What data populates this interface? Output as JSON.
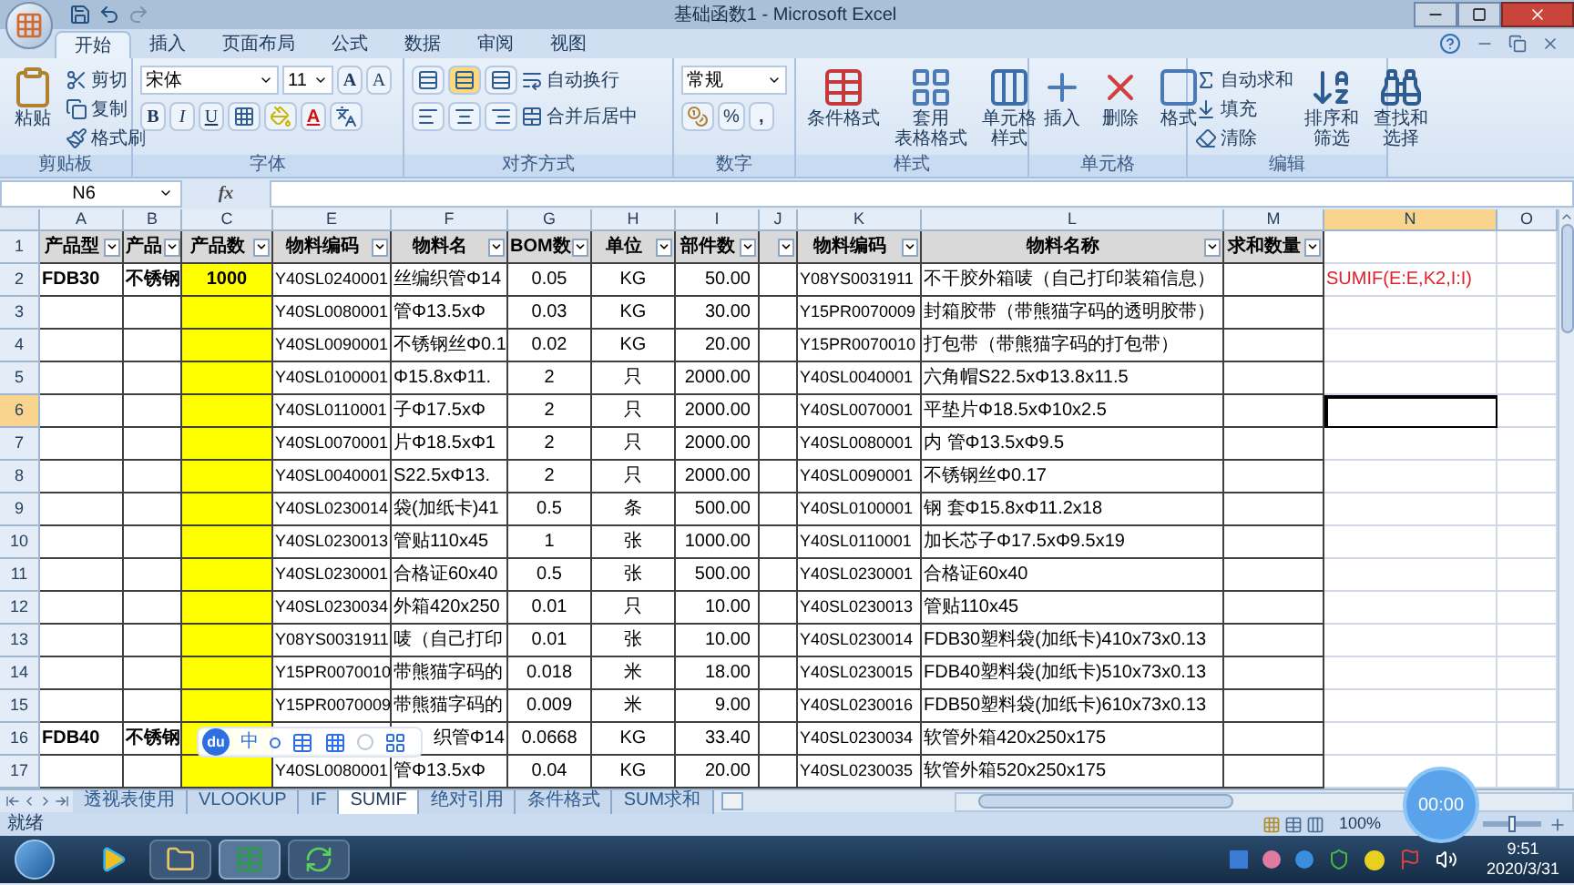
{
  "window": {
    "title": "基础函数1 - Microsoft Excel"
  },
  "ribbon_tabs": [
    {
      "label": "开始",
      "selected": true
    },
    {
      "label": "插入",
      "selected": false
    },
    {
      "label": "页面布局",
      "selected": false
    },
    {
      "label": "公式",
      "selected": false
    },
    {
      "label": "数据",
      "selected": false
    },
    {
      "label": "审阅",
      "selected": false
    },
    {
      "label": "视图",
      "selected": false
    }
  ],
  "ribbon": {
    "clipboard": {
      "label": "剪贴板",
      "paste": "粘贴",
      "small": [
        "剪切",
        "复制",
        "格式刷"
      ]
    },
    "font": {
      "label": "字体",
      "font_name": "宋体",
      "font_size": "11",
      "grow": "A",
      "shrink": "A",
      "bold": "B",
      "italic": "I",
      "underline": "U",
      "font_color": "A"
    },
    "alignment": {
      "label": "对齐方式",
      "wrap": "自动换行",
      "merge": "合并后居中"
    },
    "number": {
      "label": "数字",
      "format": "常规",
      "percent": "%",
      "comma": ","
    },
    "styles": {
      "label": "样式",
      "buttons": [
        [
          "条件格式"
        ],
        [
          "套用",
          "表格格式"
        ],
        [
          "单元格",
          "样式"
        ]
      ]
    },
    "cells": {
      "label": "单元格",
      "buttons": [
        "插入",
        "删除",
        "格式"
      ]
    },
    "editing": {
      "label": "编辑",
      "small": [
        "自动求和",
        "填充",
        "清除"
      ],
      "large": [
        [
          "排序和",
          "筛选"
        ],
        [
          "查找和",
          "选择"
        ]
      ]
    }
  },
  "name_box": "N6",
  "function_label": "fx",
  "columns": [
    {
      "label": "A",
      "selected": false
    },
    {
      "label": "B",
      "selected": false
    },
    {
      "label": "C",
      "selected": false
    },
    {
      "label": "E",
      "selected": false
    },
    {
      "label": "F",
      "selected": false
    },
    {
      "label": "G",
      "selected": false
    },
    {
      "label": "H",
      "selected": false
    },
    {
      "label": "I",
      "selected": false
    },
    {
      "label": "J",
      "selected": false
    },
    {
      "label": "K",
      "selected": false
    },
    {
      "label": "L",
      "selected": false
    },
    {
      "label": "M",
      "selected": false
    },
    {
      "label": "N",
      "selected": true
    },
    {
      "label": "O",
      "selected": false
    }
  ],
  "rows": [
    {
      "number": "1",
      "selected": false,
      "kind": "header",
      "cells": {
        "A": "产品型",
        "B": "产品",
        "C": "产品数",
        "E": "物料编码",
        "F": "物料名",
        "G": "BOM数",
        "H": "单位",
        "I": "部件数",
        "K": "物料编码",
        "L": "物料名称",
        "M": "求和数量"
      }
    },
    {
      "number": "2",
      "selected": false,
      "kind": "data",
      "cells": {
        "A": "FDB30",
        "B": "不锈钢",
        "C": "1000",
        "E": "Y40SL0240001",
        "F": "丝编织管Φ14",
        "G": "0.05",
        "H": "KG",
        "I": "50.00",
        "K": "Y08YS0031911",
        "L": "不干胶外箱唛（自己打印装箱信息）",
        "N": "SUMIF(E:E,K2,I:I)"
      }
    },
    {
      "number": "3",
      "selected": false,
      "kind": "data",
      "cells": {
        "E": "Y40SL0080001",
        "F": "管Φ13.5xΦ",
        "G": "0.03",
        "H": "KG",
        "I": "30.00",
        "K": "Y15PR0070009",
        "L": "封箱胶带（带熊猫字码的透明胶带）"
      }
    },
    {
      "number": "4",
      "selected": false,
      "kind": "data",
      "cells": {
        "E": "Y40SL0090001",
        "F": "不锈钢丝Φ0.1",
        "G": "0.02",
        "H": "KG",
        "I": "20.00",
        "K": "Y15PR0070010",
        "L": "打包带（带熊猫字码的打包带）"
      }
    },
    {
      "number": "5",
      "selected": false,
      "kind": "data",
      "cells": {
        "E": "Y40SL0100001",
        "F": "Φ15.8xΦ11.",
        "G": "2",
        "H": "只",
        "I": "2000.00",
        "K": "Y40SL0040001",
        "L": "六角帽S22.5xΦ13.8x11.5"
      }
    },
    {
      "number": "6",
      "selected": true,
      "kind": "data",
      "cells": {
        "E": "Y40SL0110001",
        "F": "子Φ17.5xΦ",
        "G": "2",
        "H": "只",
        "I": "2000.00",
        "K": "Y40SL0070001",
        "L": "平垫片Φ18.5xΦ10x2.5"
      }
    },
    {
      "number": "7",
      "selected": false,
      "kind": "data",
      "cells": {
        "E": "Y40SL0070001",
        "F": "片Φ18.5xΦ1",
        "G": "2",
        "H": "只",
        "I": "2000.00",
        "K": "Y40SL0080001",
        "L": "内 管Φ13.5xΦ9.5"
      }
    },
    {
      "number": "8",
      "selected": false,
      "kind": "data",
      "cells": {
        "E": "Y40SL0040001",
        "F": "S22.5xΦ13.",
        "G": "2",
        "H": "只",
        "I": "2000.00",
        "K": "Y40SL0090001",
        "L": "不锈钢丝Φ0.17"
      }
    },
    {
      "number": "9",
      "selected": false,
      "kind": "data",
      "cells": {
        "E": "Y40SL0230014",
        "F": "袋(加纸卡)41",
        "G": "0.5",
        "H": "条",
        "I": "500.00",
        "K": "Y40SL0100001",
        "L": "钢 套Φ15.8xΦ11.2x18"
      }
    },
    {
      "number": "10",
      "selected": false,
      "kind": "data",
      "cells": {
        "E": "Y40SL0230013",
        "F": "管贴110x45",
        "G": "1",
        "H": "张",
        "I": "1000.00",
        "K": "Y40SL0110001",
        "L": "加长芯子Φ17.5xΦ9.5x19"
      }
    },
    {
      "number": "11",
      "selected": false,
      "kind": "data",
      "cells": {
        "E": "Y40SL0230001",
        "F": "合格证60x40",
        "G": "0.5",
        "H": "张",
        "I": "500.00",
        "K": "Y40SL0230001",
        "L": "合格证60x40"
      }
    },
    {
      "number": "12",
      "selected": false,
      "kind": "data",
      "cells": {
        "E": "Y40SL0230034",
        "F": "外箱420x250",
        "G": "0.01",
        "H": "只",
        "I": "10.00",
        "K": "Y40SL0230013",
        "L": "管贴110x45"
      }
    },
    {
      "number": "13",
      "selected": false,
      "kind": "data",
      "cells": {
        "E": "Y08YS0031911",
        "F": "唛（自己打印",
        "G": "0.01",
        "H": "张",
        "I": "10.00",
        "K": "Y40SL0230014",
        "L": "FDB30塑料袋(加纸卡)410x73x0.13"
      }
    },
    {
      "number": "14",
      "selected": false,
      "kind": "data",
      "cells": {
        "E": "Y15PR0070010",
        "F": "带熊猫字码的",
        "G": "0.018",
        "H": "米",
        "I": "18.00",
        "K": "Y40SL0230015",
        "L": "FDB40塑料袋(加纸卡)510x73x0.13"
      }
    },
    {
      "number": "15",
      "selected": false,
      "kind": "data",
      "cells": {
        "E": "Y15PR0070009",
        "F": "带熊猫字码的",
        "G": "0.009",
        "H": "米",
        "I": "9.00",
        "K": "Y40SL0230016",
        "L": "FDB50塑料袋(加纸卡)610x73x0.13"
      }
    },
    {
      "number": "16",
      "selected": false,
      "kind": "data",
      "cells": {
        "A": "FDB40",
        "B": "不锈钢",
        "F": "织管Φ14",
        "G": "0.0668",
        "H": "KG",
        "I": "33.40",
        "K": "Y40SL0230034",
        "L": "软管外箱420x250x175"
      }
    },
    {
      "number": "17",
      "selected": false,
      "kind": "data",
      "cells": {
        "E": "Y40SL0080001",
        "F": "管Φ13.5xΦ",
        "G": "0.04",
        "H": "KG",
        "I": "20.00",
        "K": "Y40SL0230035",
        "L": "软管外箱520x250x175"
      }
    }
  ],
  "ime_toolbar": {
    "logo": "du",
    "mode": "中"
  },
  "sheet_tabs": [
    {
      "label": "透视表使用",
      "selected": false
    },
    {
      "label": "VLOOKUP",
      "selected": false
    },
    {
      "label": "IF",
      "selected": false
    },
    {
      "label": "SUMIF",
      "selected": true
    },
    {
      "label": "绝对引用",
      "selected": false
    },
    {
      "label": "条件格式",
      "selected": false
    },
    {
      "label": "SUM求和",
      "selected": false
    }
  ],
  "status_bar": {
    "status": "就绪",
    "zoom": "100%",
    "level": 0.5
  },
  "recorder": {
    "timer": "00:00"
  },
  "taskbar": {
    "time": "9:51",
    "date": "2020/3/31"
  }
}
